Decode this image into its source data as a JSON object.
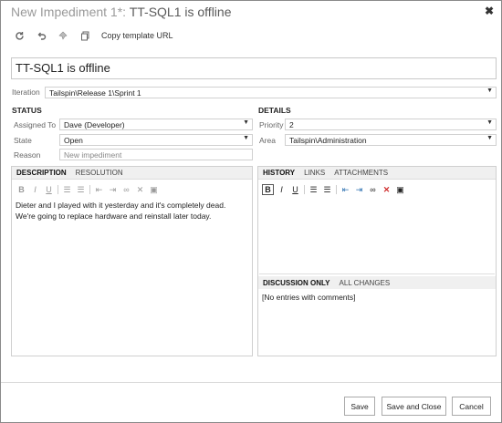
{
  "window": {
    "title_prefix": "New Impediment 1*:",
    "title_main": "TT-SQL1 is offline",
    "close_glyph": "✖"
  },
  "toolbar": {
    "icons": [
      "refresh-icon",
      "undo-icon",
      "pin-icon",
      "copy-icon"
    ],
    "copy_template_label": "Copy template URL"
  },
  "work_item": {
    "title_value": "TT-SQL1 is offline"
  },
  "iteration": {
    "label": "Iteration",
    "value": "Tailspin\\Release 1\\Sprint 1"
  },
  "status": {
    "heading": "STATUS",
    "assigned_to_label": "Assigned To",
    "assigned_to_value": "Dave (Developer)",
    "state_label": "State",
    "state_value": "Open",
    "reason_label": "Reason",
    "reason_value": "New impediment"
  },
  "details": {
    "heading": "DETAILS",
    "priority_label": "Priority",
    "priority_value": "2",
    "area_label": "Area",
    "area_value": "Tailspin\\Administration"
  },
  "left_panel": {
    "tabs": [
      "DESCRIPTION",
      "RESOLUTION"
    ],
    "description_line1": "Dieter and I played with it yesterday and it's completely dead.",
    "description_line2": "We're going to replace hardware and reinstall later today."
  },
  "right_panel": {
    "tabs": [
      "HISTORY",
      "LINKS",
      "ATTACHMENTS"
    ],
    "discussion_tabs": [
      "DISCUSSION ONLY",
      "ALL CHANGES"
    ],
    "no_entries": "[No entries with comments]"
  },
  "buttons": {
    "save": "Save",
    "save_and_close": "Save and Close",
    "cancel": "Cancel"
  }
}
